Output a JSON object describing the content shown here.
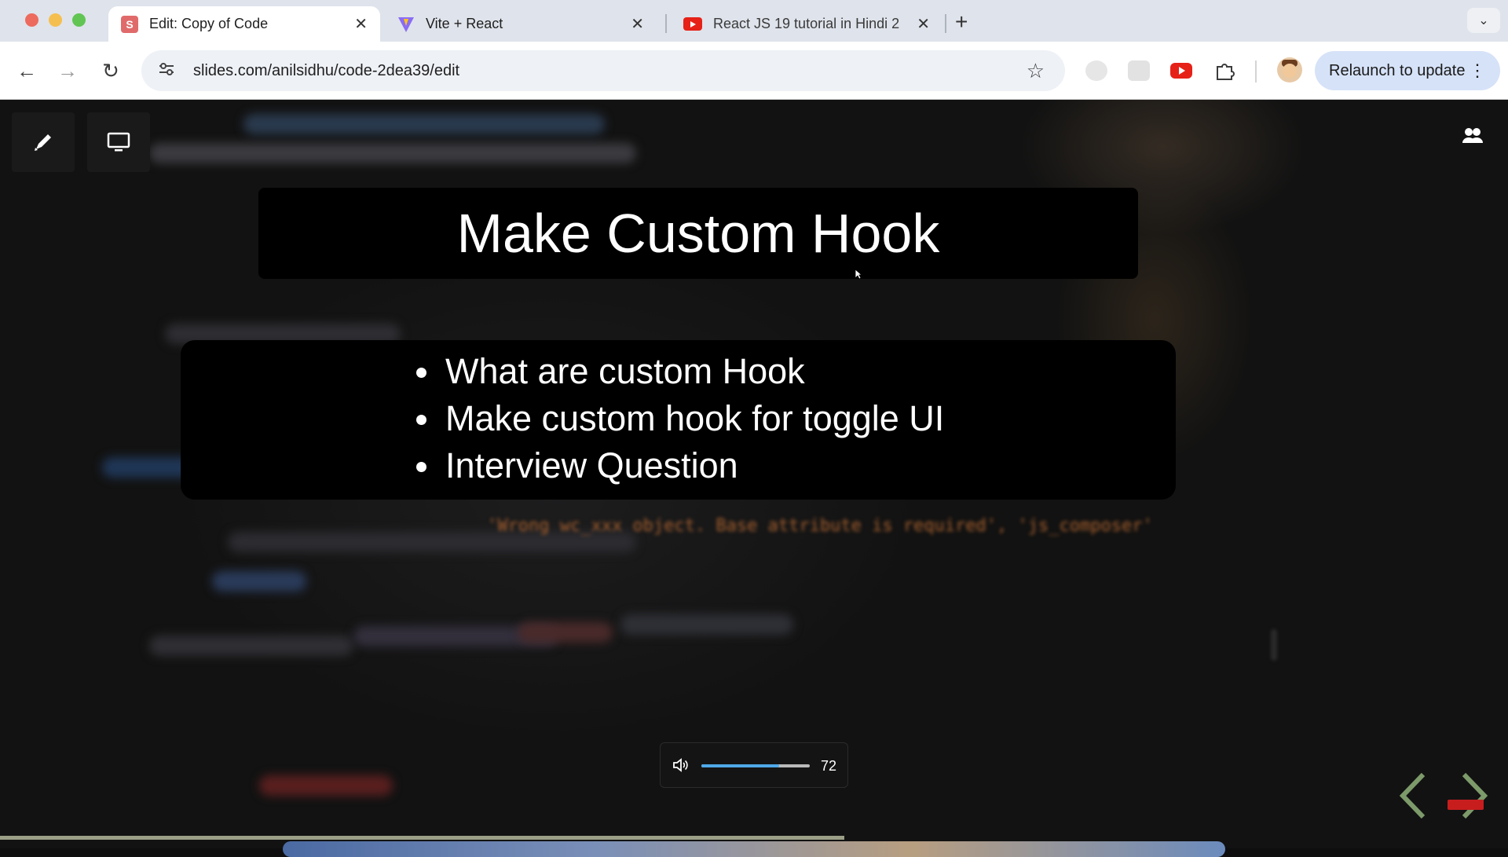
{
  "browser": {
    "tabs": [
      {
        "title": "Edit: Copy of Code",
        "favicon": "slides-icon",
        "active": true
      },
      {
        "title": "Vite + React",
        "favicon": "vite-icon",
        "active": false
      },
      {
        "title": "React JS 19 tutorial in Hindi 2",
        "favicon": "youtube-icon",
        "active": false
      }
    ],
    "url": "slides.com/anilsidhu/code-2dea39/edit",
    "relaunch_label": "Relaunch to update",
    "slides_favicon_letter": "S"
  },
  "slide": {
    "title": "Make Custom Hook",
    "bullets": [
      "What are custom Hook",
      "Make custom hook for toggle UI",
      "Interview Question"
    ],
    "background_code_text": "'Wrong wc_xxx object. Base attribute is required', 'js_composer'"
  },
  "volume": {
    "value": "72",
    "level": 0.72
  },
  "presentation_progress": 0.56,
  "colors": {
    "accent_blue": "#4fa8e8",
    "youtube_red": "#e62117",
    "slides_red": "#e06a6a"
  }
}
